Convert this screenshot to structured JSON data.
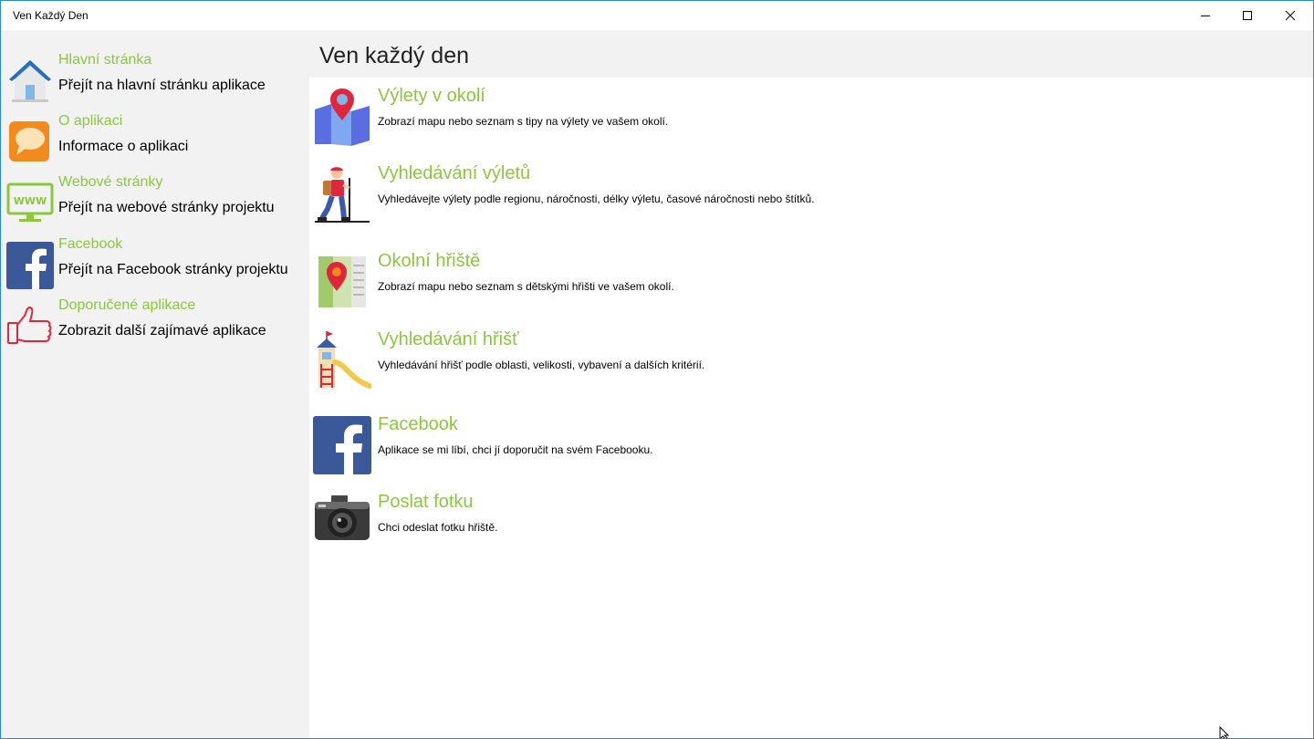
{
  "window": {
    "title": "Ven Každý Den"
  },
  "header": {
    "title": "Ven každý den"
  },
  "colors": {
    "accent_green": "#8cc63f",
    "pane_gray": "#f2f2f2",
    "window_border": "#2b88d8"
  },
  "sidebar": {
    "items": [
      {
        "icon": "house-icon",
        "title": "Hlavní stránka",
        "desc": "Přejít na hlavní stránku aplikace"
      },
      {
        "icon": "chat-bubble-icon",
        "title": "O aplikaci",
        "desc": "Informace o aplikaci"
      },
      {
        "icon": "www-monitor-icon",
        "title": "Webové stránky",
        "desc": "Přejít na webové stránky projektu"
      },
      {
        "icon": "facebook-icon",
        "title": "Facebook",
        "desc": "Přejít na Facebook stránky projektu"
      },
      {
        "icon": "thumbs-up-icon",
        "title": "Doporučené aplikace",
        "desc": "Zobrazit další zajímavé aplikace"
      }
    ]
  },
  "main": {
    "tiles": [
      {
        "icon": "map-pin-icon",
        "title": "Výlety v okolí",
        "desc": "Zobrazí mapu nebo seznam s tipy na výlety ve vašem okolí."
      },
      {
        "icon": "hiker-icon",
        "title": "Vyhledávání výletů",
        "desc": "Vyhledávejte výlety podle regionu, náročnosti, délky výletu, časové náročnosti nebo štítků."
      },
      {
        "icon": "playground-map-icon",
        "title": "Okolní hřiště",
        "desc": "Zobrazí mapu nebo seznam s dětskými hřišti ve vašem okolí."
      },
      {
        "icon": "slide-tower-icon",
        "title": "Vyhledávání hřišť",
        "desc": "Vyhledávání hřišť podle oblasti, velikosti, vybavení a dalších kritérií."
      },
      {
        "icon": "facebook-icon",
        "title": "Facebook",
        "desc": "Aplikace se mi líbí, chci jí doporučit na svém Facebooku."
      },
      {
        "icon": "camera-icon",
        "title": "Poslat fotku",
        "desc": "Chci odeslat fotku hřiště."
      }
    ]
  }
}
